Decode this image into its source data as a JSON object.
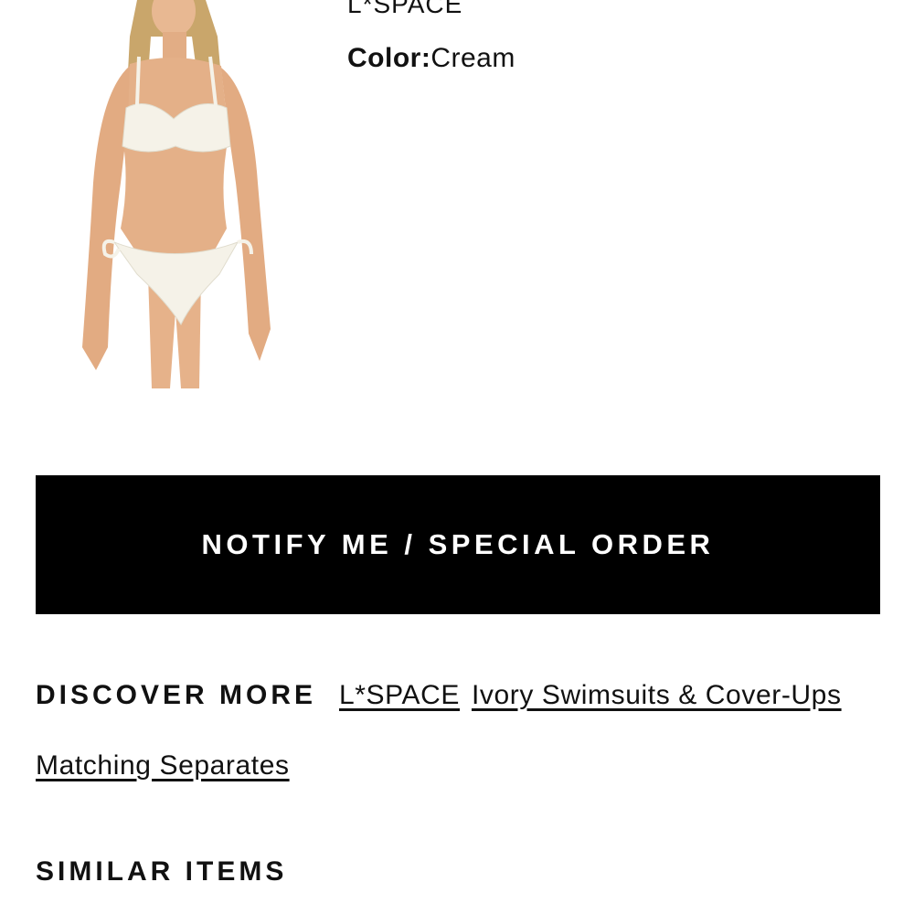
{
  "product": {
    "brand": "L*SPACE",
    "color_label": "Color:",
    "color_value": "Cream",
    "image_icon": "product-photo"
  },
  "actions": {
    "notify_label": "NOTIFY ME / SPECIAL ORDER"
  },
  "discover_more": {
    "heading": "DISCOVER MORE",
    "links": [
      "L*SPACE",
      "Ivory Swimsuits & Cover-Ups",
      "Matching Separates"
    ]
  },
  "similar_items": {
    "heading": "SIMILAR ITEMS"
  },
  "colors": {
    "button_bg": "#000000",
    "button_text": "#ffffff",
    "text": "#111111",
    "background": "#ffffff"
  }
}
